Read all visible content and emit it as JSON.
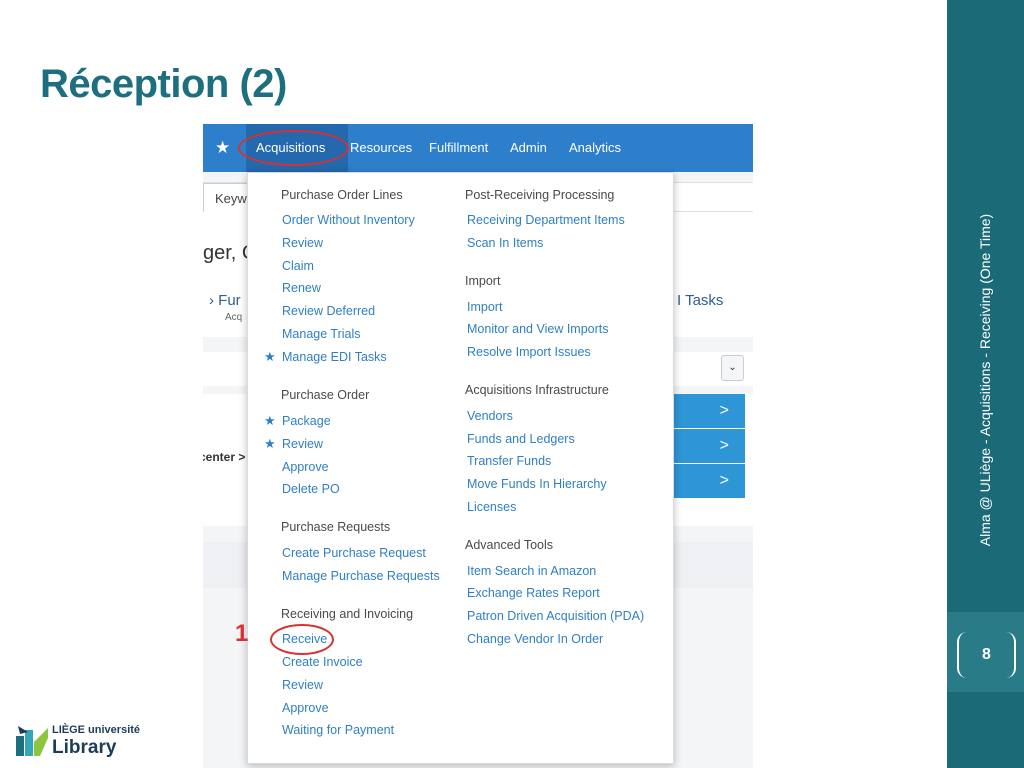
{
  "slide": {
    "title": "Réception (2)",
    "side_text": "Alma @ ULiège - Acquisitions - Receiving (One Time)",
    "page_number": "8",
    "annotation_marker": "1",
    "logo": {
      "line1": "LIÈGE université",
      "line2": "Library"
    }
  },
  "colors": {
    "teal": "#1a6a78",
    "title": "#1d6f7f",
    "nav_blue": "#2e7fcb",
    "link": "#2f7fc4",
    "annotation_red": "#d93030"
  },
  "nav": {
    "star_icon": "star-icon",
    "items": [
      "Acquisitions",
      "Resources",
      "Fulfillment",
      "Admin",
      "Analytics"
    ]
  },
  "background": {
    "search_placeholder": "Keyw",
    "ger": "ger, C",
    "fur": "Fur",
    "acq": "Acq",
    "tasks": "I Tasks",
    "center": "center >",
    "dropdown_glyph": "⌄",
    "chevron": ">"
  },
  "menu": {
    "left": [
      {
        "title": "Purchase Order Lines",
        "items": [
          {
            "label": "Order Without Inventory",
            "starred": false
          },
          {
            "label": "Review",
            "starred": false
          },
          {
            "label": "Claim",
            "starred": false
          },
          {
            "label": "Renew",
            "starred": false
          },
          {
            "label": "Review Deferred",
            "starred": false
          },
          {
            "label": "Manage Trials",
            "starred": false
          },
          {
            "label": "Manage EDI Tasks",
            "starred": true
          }
        ]
      },
      {
        "title": "Purchase Order",
        "items": [
          {
            "label": "Package",
            "starred": true
          },
          {
            "label": "Review",
            "starred": true
          },
          {
            "label": "Approve",
            "starred": false
          },
          {
            "label": "Delete PO",
            "starred": false
          }
        ]
      },
      {
        "title": "Purchase Requests",
        "items": [
          {
            "label": "Create Purchase Request",
            "starred": false
          },
          {
            "label": "Manage Purchase Requests",
            "starred": false
          }
        ]
      },
      {
        "title": "Receiving and Invoicing",
        "items": [
          {
            "label": "Receive",
            "starred": false
          },
          {
            "label": "Create Invoice",
            "starred": false
          },
          {
            "label": "Review",
            "starred": false
          },
          {
            "label": "Approve",
            "starred": false
          },
          {
            "label": "Waiting for Payment",
            "starred": false
          }
        ]
      }
    ],
    "right": [
      {
        "title": "Post-Receiving Processing",
        "items": [
          {
            "label": "Receiving Department Items"
          },
          {
            "label": "Scan In Items"
          }
        ]
      },
      {
        "title": "Import",
        "items": [
          {
            "label": "Import"
          },
          {
            "label": "Monitor and View Imports"
          },
          {
            "label": "Resolve Import Issues"
          }
        ]
      },
      {
        "title": "Acquisitions Infrastructure",
        "items": [
          {
            "label": "Vendors"
          },
          {
            "label": "Funds and Ledgers"
          },
          {
            "label": "Transfer Funds"
          },
          {
            "label": "Move Funds In Hierarchy"
          },
          {
            "label": "Licenses"
          }
        ]
      },
      {
        "title": "Advanced Tools",
        "items": [
          {
            "label": "Item Search in Amazon"
          },
          {
            "label": "Exchange Rates Report"
          },
          {
            "label": "Patron Driven Acquisition (PDA)"
          },
          {
            "label": "Change Vendor In Order"
          }
        ]
      }
    ]
  }
}
